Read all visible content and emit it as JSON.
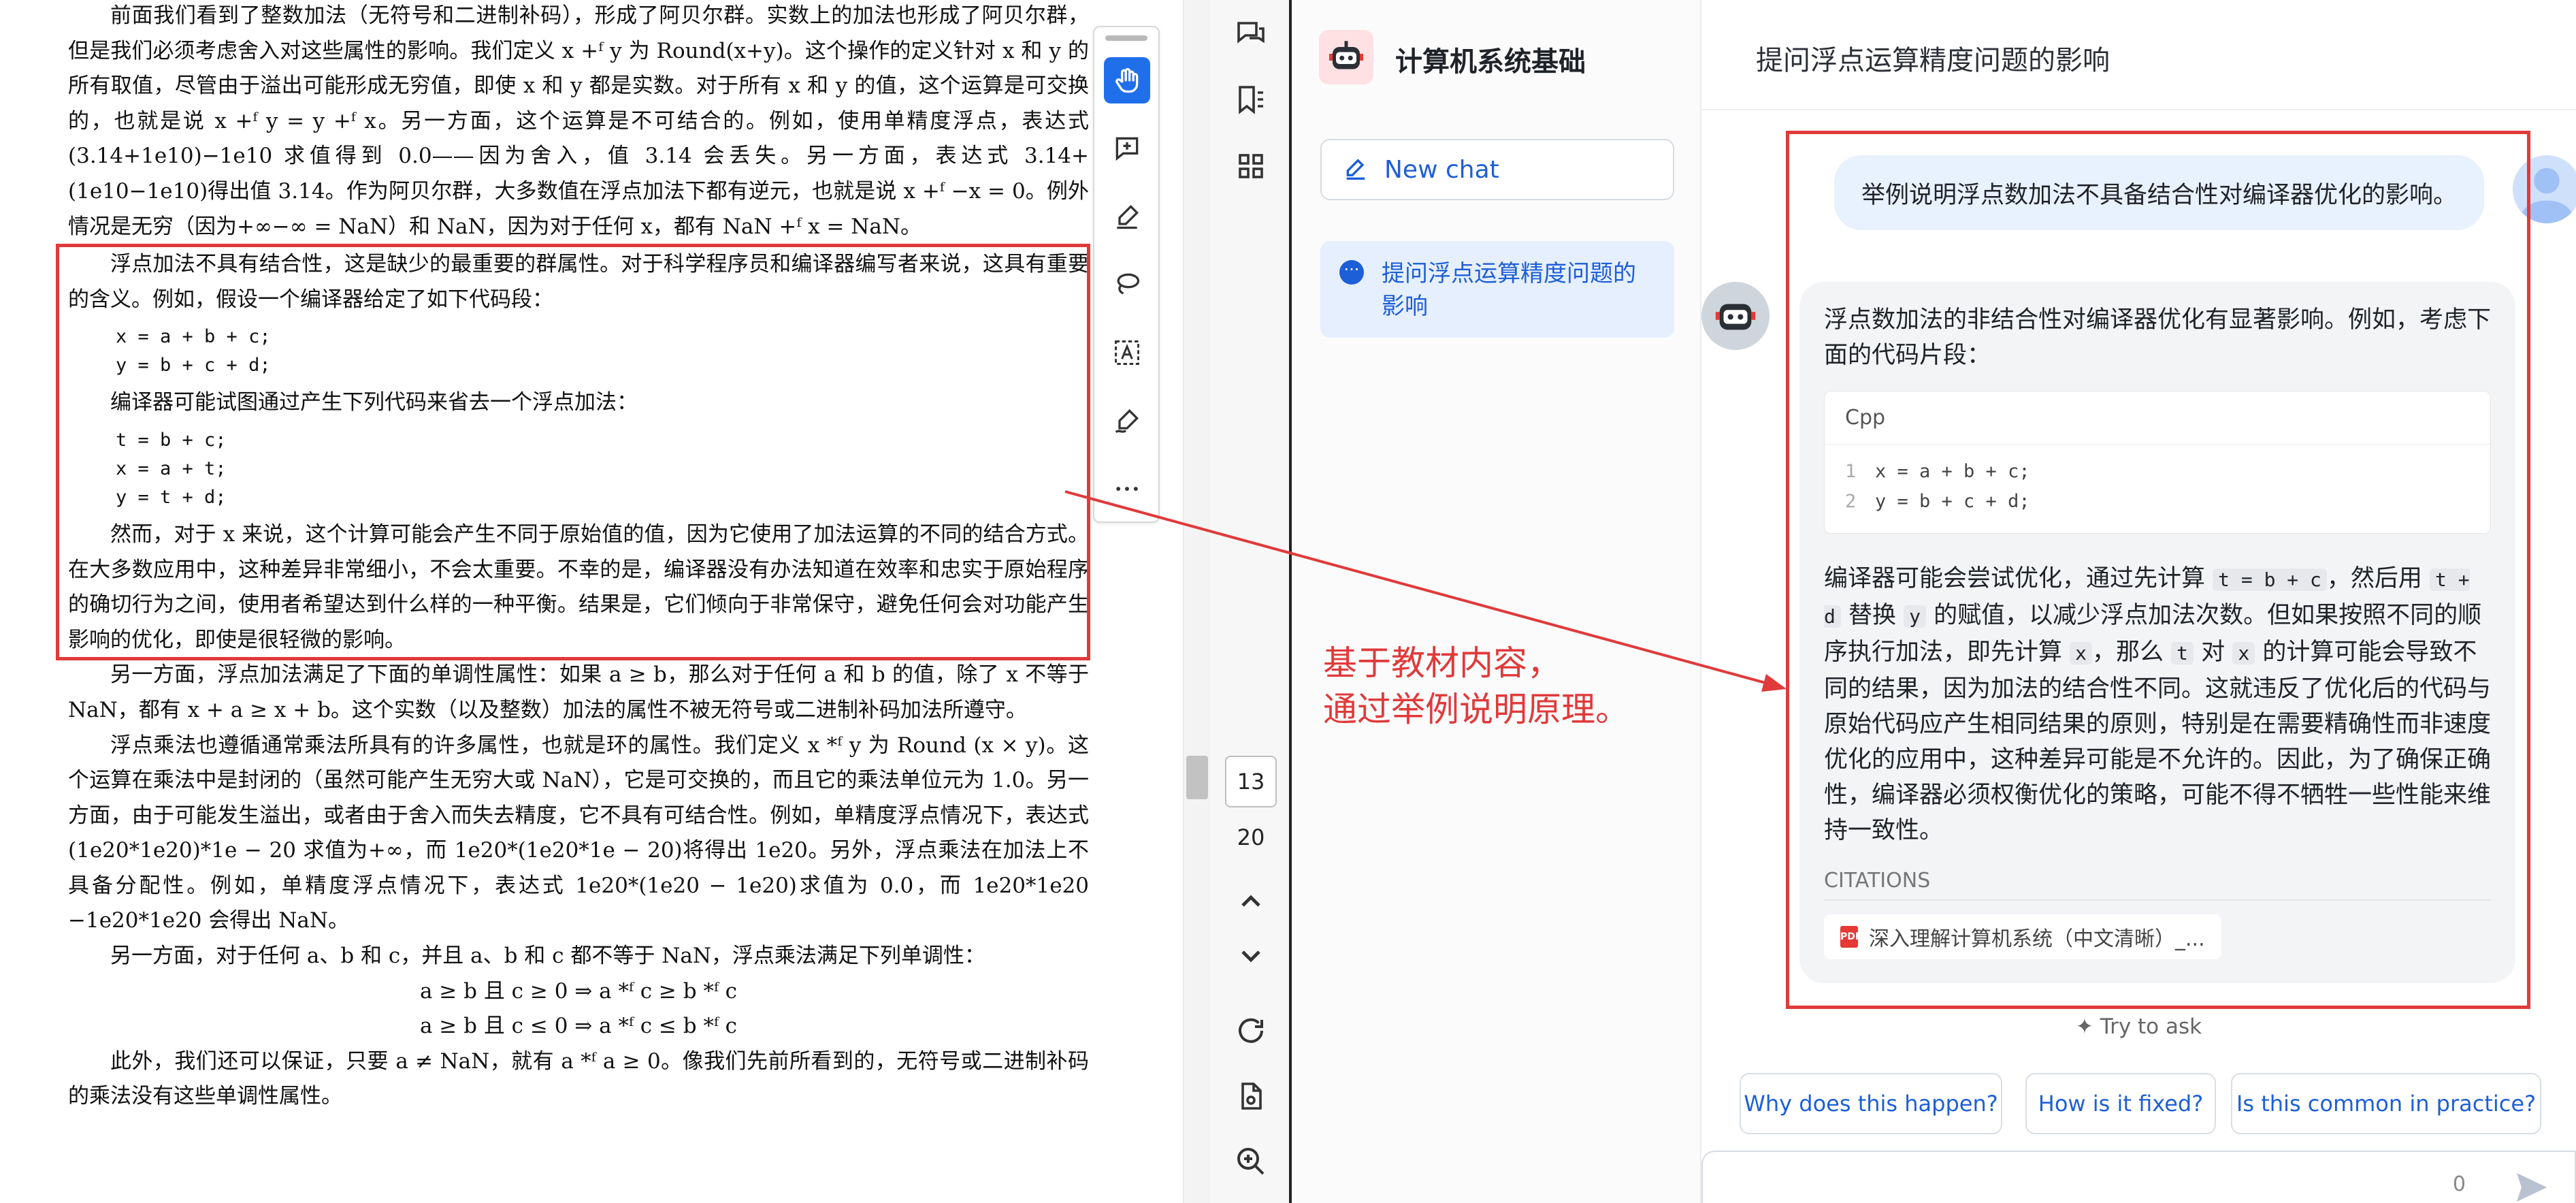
{
  "pdf": {
    "para1": "前面我们看到了整数加法（无符号和二进制补码），形成了阿贝尔群。实数上的加法也形成了阿贝尔群，但是我们必须考虑舍入对这些属性的影响。我们定义 x +ᶠ y 为 Round(x+y)。这个操作的定义针对 x 和 y 的所有取值，尽管由于溢出可能形成无穷值，即使 x 和 y 都是实数。对于所有 x 和 y 的值，这个运算是可交换的，也就是说 x +ᶠ y = y +ᶠ x。另一方面，这个运算是不可结合的。例如，使用单精度浮点，表达式(3.14+1e10)−1e10 求值得到 0.0——因为舍入，值 3.14 会丢失。另一方面，表达式 3.14+(1e10−1e10)得出值 3.14。作为阿贝尔群，大多数值在浮点加法下都有逆元，也就是说 x +ᶠ −x = 0。例外情况是无穷（因为+∞−∞ = NaN）和 NaN，因为对于任何 x，都有 NaN +ᶠ x = NaN。",
    "para2": "浮点加法不具有结合性，这是缺少的最重要的群属性。对于科学程序员和编译器编写者来说，这具有重要的含义。例如，假设一个编译器给定了如下代码段：",
    "code1": "x = a + b + c;\ny = b + c + d;",
    "para3": "编译器可能试图通过产生下列代码来省去一个浮点加法：",
    "code2": "t = b + c;\nx = a + t;\ny = t + d;",
    "para4": "然而，对于 x 来说，这个计算可能会产生不同于原始值的值，因为它使用了加法运算的不同的结合方式。在大多数应用中，这种差异非常细小，不会太重要。不幸的是，编译器没有办法知道在效率和忠实于原始程序的确切行为之间，使用者希望达到什么样的一种平衡。结果是，它们倾向于非常保守，避免任何会对功能产生影响的优化，即使是很轻微的影响。",
    "para5": "另一方面，浮点加法满足了下面的单调性属性：如果 a ≥ b，那么对于任何 a 和 b 的值，除了 x 不等于 NaN，都有 x + a ≥ x + b。这个实数（以及整数）加法的属性不被无符号或二进制补码加法所遵守。",
    "para6": "浮点乘法也遵循通常乘法所具有的许多属性，也就是环的属性。我们定义 x *ᶠ y 为 Round (x × y)。这个运算在乘法中是封闭的（虽然可能产生无穷大或 NaN），它是可交换的，而且它的乘法单位元为 1.0。另一方面，由于可能发生溢出，或者由于舍入而失去精度，它不具有可结合性。例如，单精度浮点情况下，表达式(1e20*1e20)*1e − 20 求值为+∞，而 1e20*(1e20*1e − 20)将得出 1e20。另外，浮点乘法在加法上不具备分配性。例如，单精度浮点情况下，表达式 1e20*(1e20 − 1e20)求值为 0.0，而 1e20*1e20 −1e20*1e20 会得出 NaN。",
    "para7": "另一方面，对于任何 a、b 和 c，并且 a、b 和 c 都不等于 NaN，浮点乘法满足下列单调性：",
    "math1": "a ≥ b 且 c ≥ 0  ⇒  a *ᶠ c ≥ b *ᶠ c",
    "math2": "a ≥ b 且 c ≤ 0  ⇒  a *ᶠ c ≤ b *ᶠ c",
    "para8": "此外，我们还可以保证，只要 a ≠ NaN，就有 a *ᶠ a ≥ 0。像我们先前所看到的，无符号或二进制补码的乘法没有这些单调性属性。"
  },
  "pager": {
    "current": "13",
    "total": "20"
  },
  "sidebar": {
    "title": "计算机系统基础",
    "new_chat": "New chat",
    "chat_item": "提问浮点运算精度问题的影响"
  },
  "chat": {
    "header": "提问浮点运算精度问题的影响",
    "user_question": "举例说明浮点数加法不具备结合性对编译器优化的影响。",
    "answer_intro": "浮点数加法的非结合性对编译器优化有显著影响。例如，考虑下面的代码片段：",
    "code_lang": "Cpp",
    "code_lines": [
      {
        "n": "1",
        "text": "x = a + b + c;"
      },
      {
        "n": "2",
        "text": "y = b + c + d;"
      }
    ],
    "answer_p1": "编译器可能会尝试优化，通过先计算",
    "answer_c1": "t = b + c",
    "answer_p2": "，然后用",
    "answer_c2": "t + d",
    "answer_p3": "替换",
    "answer_c3": "y",
    "answer_p4": "的赋值，以减少浮点加法次数。但如果按照不同的顺序执行加法，即先计算",
    "answer_c4": "x",
    "answer_p5": "，那么",
    "answer_c5": "t",
    "answer_p6": "对",
    "answer_c6": "x",
    "answer_p7": "的计算可能会导致不同的结果，因为加法的结合性不同。这就违反了优化后的代码与原始代码应产生相同结果的原则，特别是在需要精确性而非速度优化的应用中，这种差异可能是不允许的。因此，为了确保正确性，编译器必须权衡优化的策略，可能不得不牺牲一些性能来维持一致性。",
    "citations_label": "CITATIONS",
    "citation": "深入理解计算机系统（中文清晰）_...",
    "try_ask": "✦ Try to ask",
    "suggestions": [
      "Why does this happen?",
      "How is it fixed?",
      "Is this common in practice?"
    ],
    "char_count": "0"
  },
  "annotation": {
    "line1": "基于教材内容，",
    "line2": "通过举例说明原理。"
  },
  "colors": {
    "accent": "#1d5fd6",
    "highlight": "#e03a3a",
    "active_tool": "#1f6feb"
  }
}
